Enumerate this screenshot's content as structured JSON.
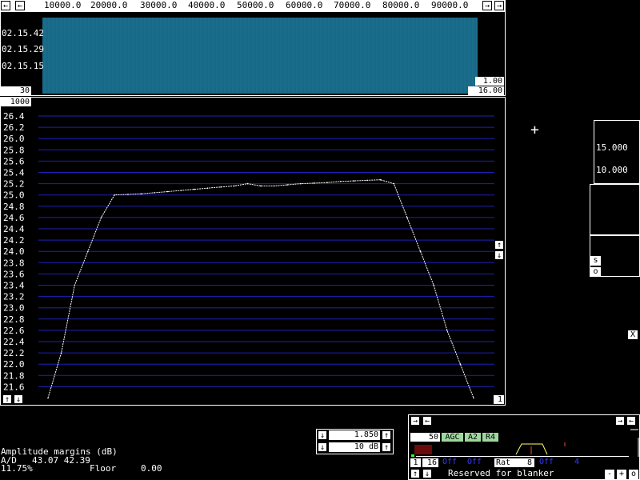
{
  "freq_axis": {
    "labels": [
      "10000.0",
      "20000.0",
      "30000.0",
      "40000.0",
      "50000.0",
      "60000.0",
      "70000.0",
      "80000.0",
      "90000.0"
    ]
  },
  "waterfall": {
    "timestamps": [
      "02.15.42",
      "02.15.29",
      "02.15.15"
    ],
    "left_box": "30",
    "right_box_top": "1.00",
    "right_box_bottom": "16.00"
  },
  "spectrum": {
    "top_box": "1000",
    "bottom_right_box": "1",
    "y_ticks": [
      "26.4",
      "26.2",
      "26.0",
      "25.8",
      "25.6",
      "25.4",
      "25.2",
      "25.0",
      "24.8",
      "24.6",
      "24.4",
      "24.2",
      "24.0",
      "23.8",
      "23.6",
      "23.4",
      "23.2",
      "23.0",
      "22.8",
      "22.6",
      "22.4",
      "22.2",
      "22.0",
      "21.8",
      "21.6"
    ]
  },
  "chart_data": {
    "type": "line",
    "y_axis_ticks": [
      26.4,
      26.2,
      26.0,
      25.8,
      25.6,
      25.4,
      25.2,
      25.0,
      24.8,
      24.6,
      24.4,
      24.2,
      24.0,
      23.8,
      23.6,
      23.4,
      23.2,
      23.0,
      22.8,
      22.6,
      22.4,
      22.2,
      22.0,
      21.8,
      21.6
    ],
    "ylim": [
      21.6,
      26.4
    ],
    "grid": true,
    "series": [
      {
        "values": [
          21.4,
          22.2,
          23.4,
          24.0,
          24.6,
          25.0,
          25.01,
          25.02,
          25.04,
          25.06,
          25.08,
          25.1,
          25.12,
          25.14,
          25.16,
          25.2,
          25.16,
          25.16,
          25.18,
          25.2,
          25.21,
          25.22,
          25.24,
          25.25,
          25.26,
          25.27,
          25.2,
          24.6,
          24.0,
          23.4,
          22.6,
          22.0,
          21.4
        ]
      }
    ]
  },
  "side_panel": {
    "value_top": "15.000",
    "value_bottom": "10.000",
    "s_button": "s",
    "o_button": "o"
  },
  "x_button": "X",
  "cursor_cross": "+",
  "amplitude": {
    "title": "Amplitude margins (dB)",
    "ad_label": "A/D",
    "ad_values": "43.07 42.39",
    "percent": "11.75%",
    "floor_label": "Floor",
    "floor_value": "0.00"
  },
  "gain_controls": {
    "value1": "1.850",
    "value2": "10 dB"
  },
  "rx_panel": {
    "value_50": "50",
    "agc": "AGC",
    "a2": "A2",
    "r4": "R4",
    "box_1": "1",
    "box_16": "16",
    "off1": "Off",
    "off2": "Off",
    "rat_label": "Rat",
    "rat_value": "8",
    "off3": "Off",
    "val4": "4",
    "blanker_text": "Reserved for blanker",
    "minus": "-",
    "plus": "+",
    "o": "o"
  },
  "colors": {
    "waterfall": "#1a6e8c",
    "grid": "#1f1fb8",
    "trace": "#ffffff",
    "green_label": "#9fd89f",
    "blue_label": "#3a3aff"
  }
}
